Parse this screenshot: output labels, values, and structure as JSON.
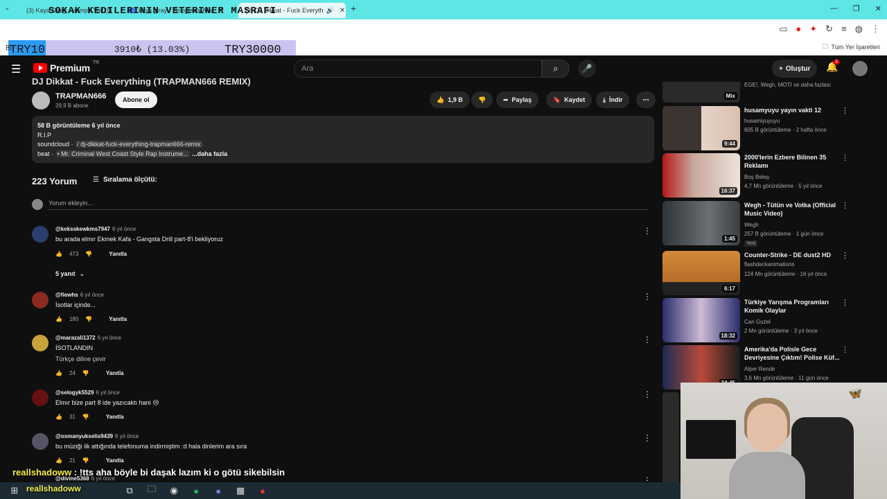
{
  "browser": {
    "tabs": [
      {
        "label": "(3) Kaya Giray - Vampir Yok (O"
      },
      {
        "label": "kaya giray - Google'da Ara"
      },
      {
        "label": "(3) DJ Dikkat - Fuck Everyth"
      }
    ],
    "window_icons": [
      "minimize-icon",
      "restore-icon",
      "close-icon"
    ],
    "bookmarks_label": "Tüm Yer İşaretleri"
  },
  "donation": {
    "title": "SOKAK KEDILERININ VETERINER MASRAFI",
    "progress_text": "3910₺ (13.03%)",
    "progress_fraction": 0.1303,
    "min_label": "TRY10",
    "max_label": "TRY30000",
    "fill_color": "#2c9bf0",
    "track_color": "#c9c4ef"
  },
  "header": {
    "logo_text": "Premium",
    "logo_sup": "TR",
    "search_placeholder": "Ara",
    "create_label": "Oluştur",
    "notif_count": "3"
  },
  "video": {
    "title": "DJ Dikkat - Fuck Everything (TRAPMAN666 REMIX)",
    "channel": "TRAPMAN666",
    "subs": "29,9 B abone",
    "subscribe_label": "Abone ol",
    "likes": "1,9 B",
    "share_label": "Paylaş",
    "save_label": "Kaydet",
    "download_label": "İndir",
    "desc_stats": "58 B görüntüleme  6 yıl önce",
    "desc_line1": "R.I.P",
    "desc_sc_prefix": "soundcloud ·",
    "desc_sc_link": "/ dj-dikkat-fuck-everything-trapman666-remix",
    "desc_beat_prefix": "beat ·",
    "desc_beat_link": "• Mr. Criminal West Coast Style Rap Instrume...",
    "desc_more": "...daha fazla"
  },
  "comments_section": {
    "count_label": "223 Yorum",
    "sort_label": "Sıralama ölçütü:",
    "add_placeholder": "Yorum ekleyin...",
    "reply_label": "Yanıtla",
    "replies_toggle": "5 yanıt",
    "comments": [
      {
        "user": "@keksskewkms7947",
        "when": "6 yıl önce",
        "text": "bu arada elmır Ekmek Kafa - Gangsta Drill part-8'i bekliyoruz",
        "text2": "",
        "likes": "473"
      },
      {
        "user": "@fiewhs",
        "when": "6 yıl önce",
        "text": "İsotlar içinde...",
        "text2": "",
        "likes": "180"
      },
      {
        "user": "@marazali1372",
        "when": "6 yıl önce",
        "text": "İSOTLANDIN",
        "text2": "Türkçe diline çevir",
        "likes": "24"
      },
      {
        "user": "@selogyk5529",
        "when": "6 yıl önce",
        "text": "Elmır bize part 8 ide yazıcaktı hani 😢",
        "text2": "",
        "likes": "31"
      },
      {
        "user": "@osmanyukselis9439",
        "when": "6 yıl önce",
        "text": "bu müziği ilk attığında telefonuma indirmiştim :d hala dinlerim ara sıra",
        "text2": "",
        "likes": "21"
      },
      {
        "user": "@divine5368",
        "when": "6 yıl önce",
        "text": "",
        "text2": "",
        "likes": ""
      }
    ]
  },
  "sidebar": {
    "items": [
      {
        "title": "",
        "channel": "EGE!, Wegh, MOTI ve daha fazlası",
        "meta": "",
        "duration": "Mix"
      },
      {
        "title": "husamyuyu yayın vakti 12",
        "channel": "husamiyuyuyu",
        "meta": "605 B görüntüleme · 2 hafta önce",
        "duration": "9:44"
      },
      {
        "title": "2000'lerin Ezbere Bilinen 35 Reklamı",
        "channel": "Boş Beleş",
        "meta": "4,7 Mn görüntüleme · 5 yıl önce",
        "duration": "16:37"
      },
      {
        "title": "Wegh - Tütün ve Votka (Official Music Video)",
        "channel": "Wegh",
        "meta": "257 B görüntüleme · 1 gün önce",
        "duration": "1:45",
        "badge": "Yeni"
      },
      {
        "title": "Counter-Strike - DE dust2 HD",
        "channel": "flashdeckanimations",
        "meta": "124 Mn görüntüleme · 16 yıl önce",
        "duration": "6:17"
      },
      {
        "title": "Türkiye Yarışma Programları Komik Olaylar",
        "channel": "Can Guzel",
        "meta": "2 Mn görüntüleme · 3 yıl önce",
        "duration": "18:32"
      },
      {
        "title": "Amerika'da Polisle Gece Devriyesine Çıktım! Polise Küf...",
        "channel": "Alper Rende",
        "meta": "3,6 Mn görüntüleme · 11 gün önce",
        "duration": "34:45"
      }
    ]
  },
  "chat": {
    "nick": "reallshadoww",
    "message": " : !tts aha böyle bi daşak lazım ki o götü sikebilsin",
    "taskbar_nick": "reallshadoww"
  }
}
